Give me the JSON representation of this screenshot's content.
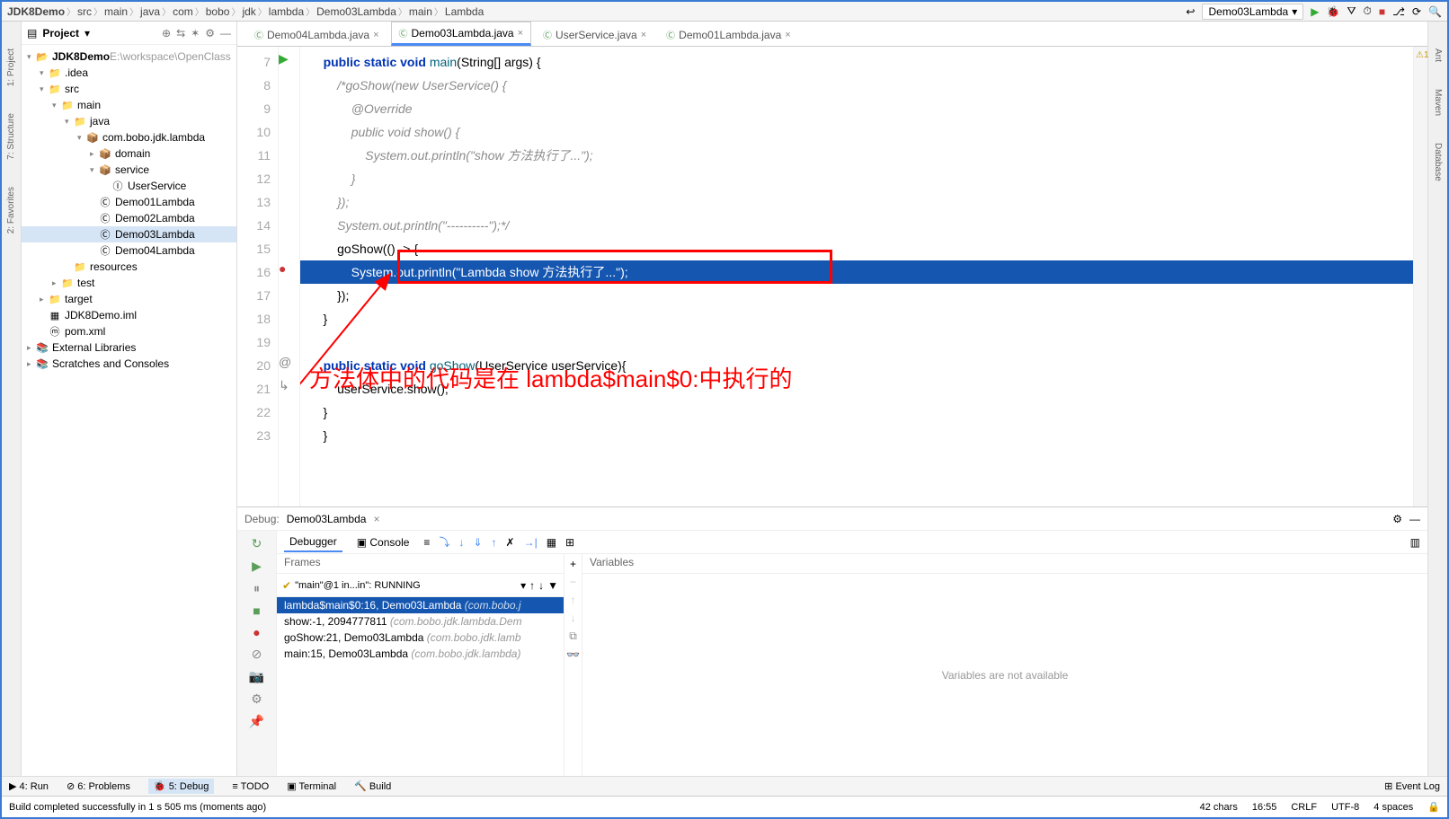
{
  "breadcrumb": [
    "JDK8Demo",
    "src",
    "main",
    "java",
    "com",
    "bobo",
    "jdk",
    "lambda",
    "Demo03Lambda",
    "main",
    "Lambda"
  ],
  "runConfig": "Demo03Lambda",
  "project": {
    "title": "Project",
    "root": "JDK8Demo",
    "rootPath": "E:\\workspace\\OpenClass",
    "tree": [
      {
        "t": ".idea",
        "d": 1,
        "exp": true,
        "ic": "📁"
      },
      {
        "t": "src",
        "d": 1,
        "exp": true,
        "ic": "📁"
      },
      {
        "t": "main",
        "d": 2,
        "exp": true,
        "ic": "📁"
      },
      {
        "t": "java",
        "d": 3,
        "exp": true,
        "ic": "📁"
      },
      {
        "t": "com.bobo.jdk.lambda",
        "d": 4,
        "exp": true,
        "ic": "📦"
      },
      {
        "t": "domain",
        "d": 5,
        "exp": false,
        "ic": "📦"
      },
      {
        "t": "service",
        "d": 5,
        "exp": true,
        "ic": "📦"
      },
      {
        "t": "UserService",
        "d": 6,
        "ic": "Ⓘ"
      },
      {
        "t": "Demo01Lambda",
        "d": 5,
        "ic": "Ⓒ"
      },
      {
        "t": "Demo02Lambda",
        "d": 5,
        "ic": "Ⓒ"
      },
      {
        "t": "Demo03Lambda",
        "d": 5,
        "ic": "Ⓒ",
        "sel": true
      },
      {
        "t": "Demo04Lambda",
        "d": 5,
        "ic": "Ⓒ"
      },
      {
        "t": "resources",
        "d": 3,
        "ic": "📁"
      },
      {
        "t": "test",
        "d": 2,
        "exp": false,
        "ic": "📁"
      },
      {
        "t": "target",
        "d": 1,
        "exp": false,
        "ic": "📁"
      },
      {
        "t": "JDK8Demo.iml",
        "d": 1,
        "ic": "▦"
      },
      {
        "t": "pom.xml",
        "d": 1,
        "ic": "ⓜ"
      }
    ],
    "extLib": "External Libraries",
    "scratches": "Scratches and Consoles"
  },
  "tabs": [
    {
      "label": "Demo04Lambda.java",
      "active": false
    },
    {
      "label": "Demo03Lambda.java",
      "active": true
    },
    {
      "label": "UserService.java",
      "active": false
    },
    {
      "label": "Demo01Lambda.java",
      "active": false
    }
  ],
  "code": {
    "startLine": 7,
    "lines": [
      {
        "html": "<span class='kw'>public static void</span> <span class='mtd'>main</span>(String[] args) {"
      },
      {
        "html": "    <span class='cm'>/*goShow(new UserService() {</span>"
      },
      {
        "html": "        <span class='cm'>@Override</span>"
      },
      {
        "html": "        <span class='cm'>public void show() {</span>"
      },
      {
        "html": "            <span class='cm'>System.out.println(\"show 方法执行了...\");</span>"
      },
      {
        "html": "        <span class='cm'>}</span>"
      },
      {
        "html": "    <span class='cm'>});</span>"
      },
      {
        "html": "    <span class='cm'>System.out.println(\"----------\");*/</span>"
      },
      {
        "html": "    goShow(() -> {"
      },
      {
        "html": "        System.<span class='st'>out</span>.println(<span class='st'>\"Lambda show 方法执行了...\"</span>);",
        "hl": true,
        "bp": true
      },
      {
        "html": "    });"
      },
      {
        "html": "}"
      },
      {
        "html": ""
      },
      {
        "html": "<span class='kw'>public static void</span> <span class='mtd'>goShow</span>(UserService userService){"
      },
      {
        "html": "    userService.show();"
      },
      {
        "html": "}"
      },
      {
        "html": "}"
      }
    ]
  },
  "annotation": "方法体中的代码是在 lambda$main$0:中执行的",
  "debug": {
    "label": "Debug:",
    "name": "Demo03Lambda",
    "tabDebugger": "Debugger",
    "tabConsole": "Console",
    "framesLabel": "Frames",
    "varsLabel": "Variables",
    "thread": "\"main\"@1 in...in\": RUNNING",
    "frames": [
      {
        "t": "lambda$main$0:16, Demo03Lambda",
        "g": "(com.bobo.j",
        "sel": true
      },
      {
        "t": "show:-1, 2094777811",
        "g": "(com.bobo.jdk.lambda.Dem"
      },
      {
        "t": "goShow:21, Demo03Lambda",
        "g": "(com.bobo.jdk.lamb"
      },
      {
        "t": "main:15, Demo03Lambda",
        "g": "(com.bobo.jdk.lambda)"
      }
    ],
    "varsMsg": "Variables are not available"
  },
  "bottomTools": {
    "run": "4: Run",
    "problems": "6: Problems",
    "debug": "5: Debug",
    "todo": "TODO",
    "terminal": "Terminal",
    "build": "Build",
    "eventLog": "Event Log"
  },
  "status": {
    "msg": "Build completed successfully in 1 s 505 ms (moments ago)",
    "chars": "42 chars",
    "pos": "16:55",
    "crlf": "CRLF",
    "enc": "UTF-8",
    "indent": "4 spaces",
    "warn": "1"
  },
  "rightTools": {
    "ant": "Ant",
    "maven": "Maven",
    "db": "Database"
  }
}
